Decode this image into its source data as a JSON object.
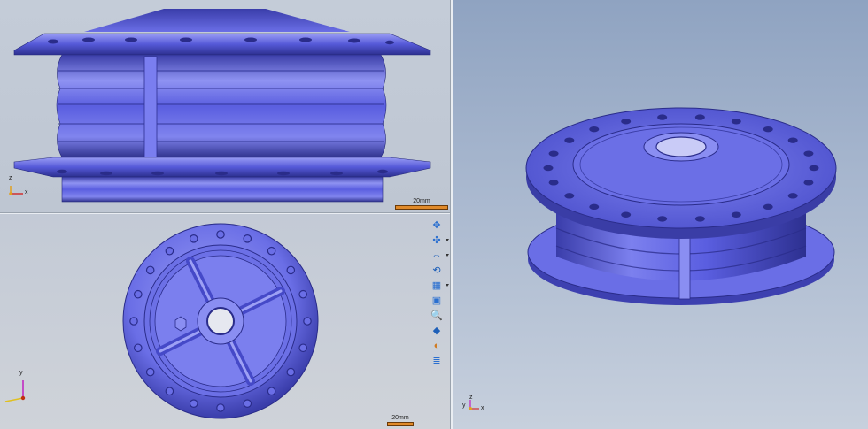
{
  "viewports": {
    "front": {
      "name": "front-view",
      "scale_label": "20mm",
      "axis_labels": {
        "z": "z",
        "x": "x"
      }
    },
    "top": {
      "name": "top-view",
      "scale_label": "20mm",
      "axis_labels": {
        "y": "y"
      }
    },
    "iso": {
      "name": "isometric-view",
      "axis_labels": {
        "y": "y",
        "z": "z",
        "x": "x"
      }
    }
  },
  "colors": {
    "part": "#5a5ee0",
    "part_dark": "#2a2c8a",
    "part_light": "#a3a6f6",
    "scale_bar": "#e08a2a",
    "axis_z": "#e0a020",
    "axis_x": "#d03030",
    "axis_y": "#c020c0"
  },
  "toolbar": {
    "buttons": [
      {
        "name": "pan-icon",
        "glyph": "✥",
        "has_menu": false
      },
      {
        "name": "rotate-icon",
        "glyph": "✣",
        "has_menu": true
      },
      {
        "name": "zoom-window-icon",
        "glyph": "⇔",
        "has_menu": true
      },
      {
        "name": "orbit-icon",
        "glyph": "⟲",
        "has_menu": false
      },
      {
        "name": "view-layout-icon",
        "glyph": "▦",
        "has_menu": true
      },
      {
        "name": "fit-view-icon",
        "glyph": "▣",
        "has_menu": false
      },
      {
        "name": "zoom-icon",
        "glyph": "🔍",
        "has_menu": false
      },
      {
        "name": "shaded-cube-icon",
        "glyph": "◆",
        "has_menu": false
      },
      {
        "name": "appearance-icon",
        "glyph": "◐",
        "has_menu": false
      },
      {
        "name": "properties-icon",
        "glyph": "≣",
        "has_menu": false
      }
    ]
  }
}
